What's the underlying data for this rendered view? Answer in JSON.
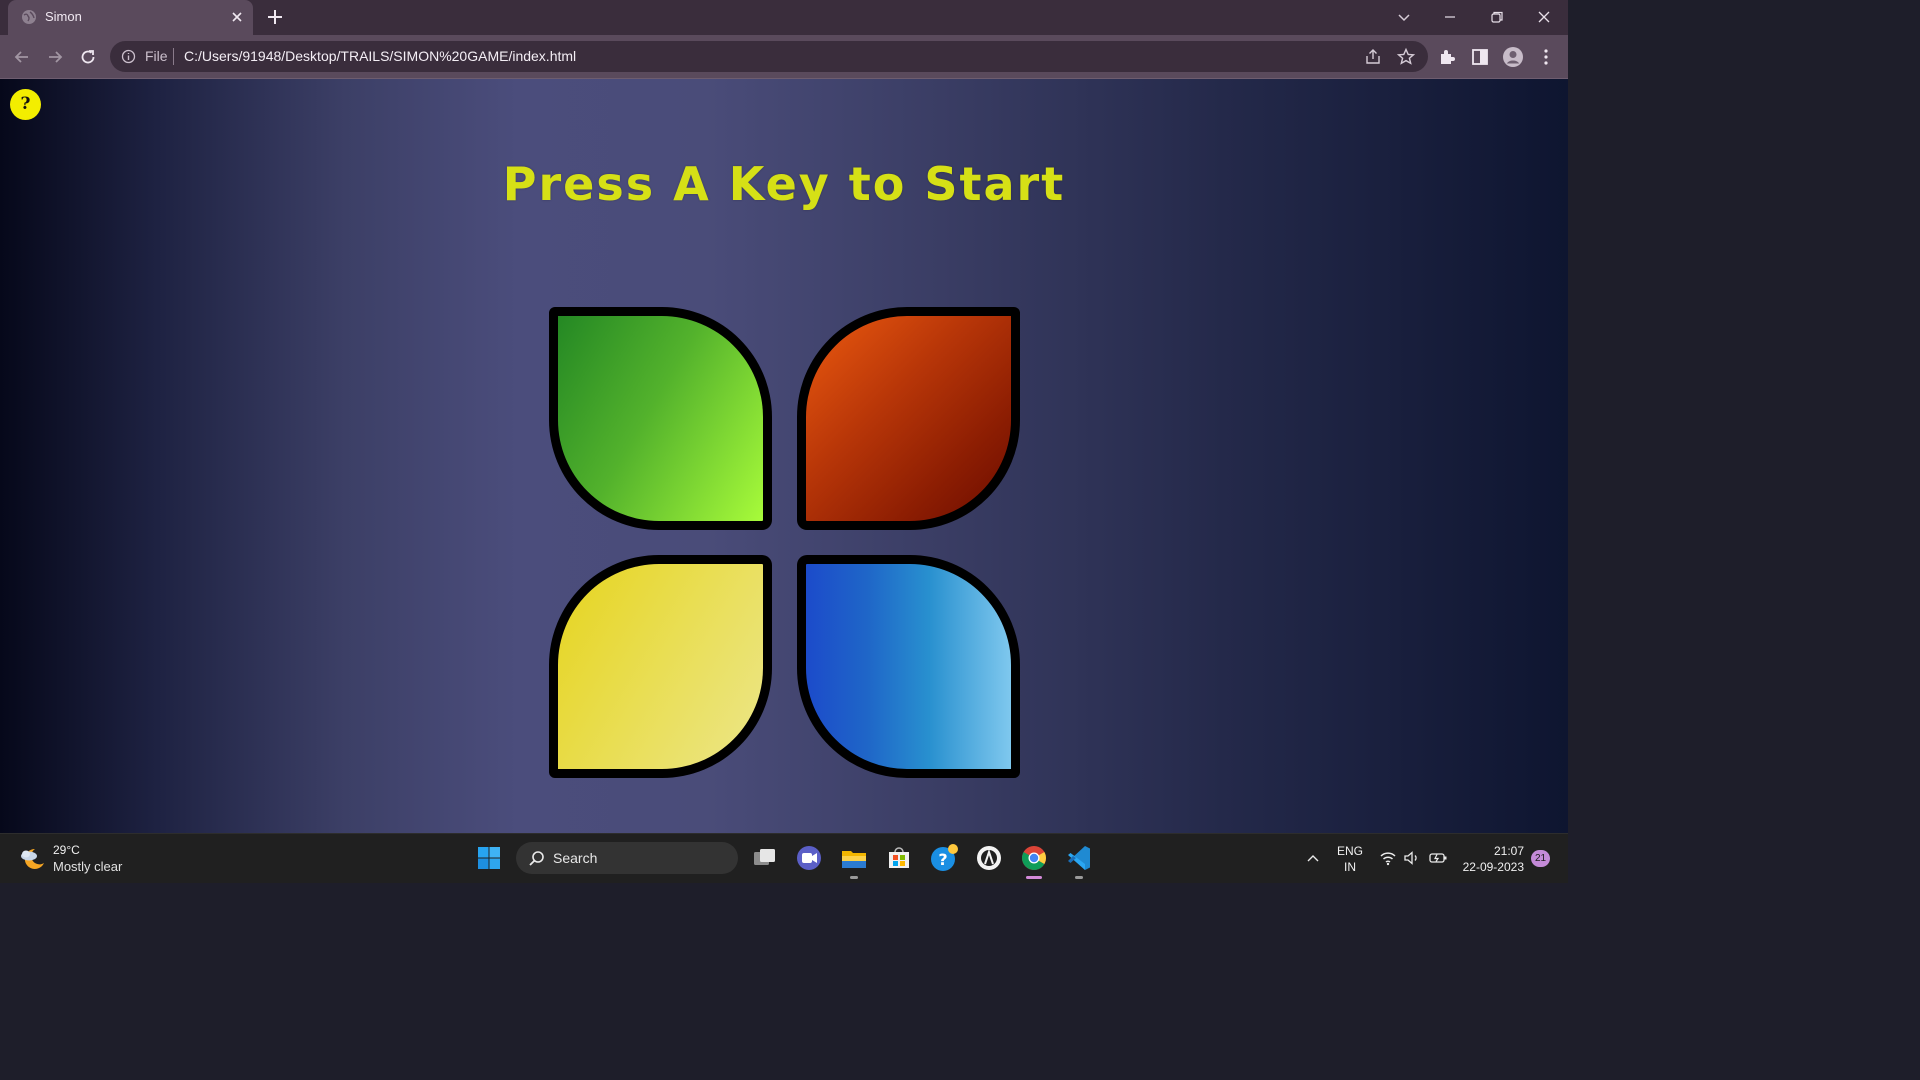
{
  "browser": {
    "tab_title": "Simon",
    "url_scheme_label": "File",
    "url": "C:/Users/91948/Desktop/TRAILS/SIMON%20GAME/index.html",
    "icons": [
      "globe-icon",
      "close-icon",
      "plus-icon",
      "chevron-down-icon",
      "minimize-icon",
      "restore-icon",
      "back-icon",
      "forward-icon",
      "reload-icon",
      "info-icon",
      "share-icon",
      "star-icon",
      "extensions-icon",
      "side-panel-icon",
      "profile-icon",
      "menu-icon"
    ]
  },
  "page": {
    "help_label": "?",
    "title": "Press A Key to Start",
    "pads": [
      {
        "id": "green",
        "color": "#53b22c"
      },
      {
        "id": "red",
        "color": "#b83608"
      },
      {
        "id": "yellow",
        "color": "#e9de54"
      },
      {
        "id": "blue",
        "color": "#2890cf"
      }
    ],
    "title_color": "#d6e016"
  },
  "taskbar": {
    "weather_temp": "29°C",
    "weather_desc": "Mostly clear",
    "search_label": "Search",
    "apps": [
      "windows-start-icon",
      "task-view-icon",
      "meet-icon",
      "file-explorer-icon",
      "store-icon",
      "help-app-icon",
      "app-icon",
      "chrome-icon",
      "vscode-icon"
    ],
    "lang_top": "ENG",
    "lang_bottom": "IN",
    "time": "21:07",
    "date": "22-09-2023",
    "notification_count": "21"
  }
}
